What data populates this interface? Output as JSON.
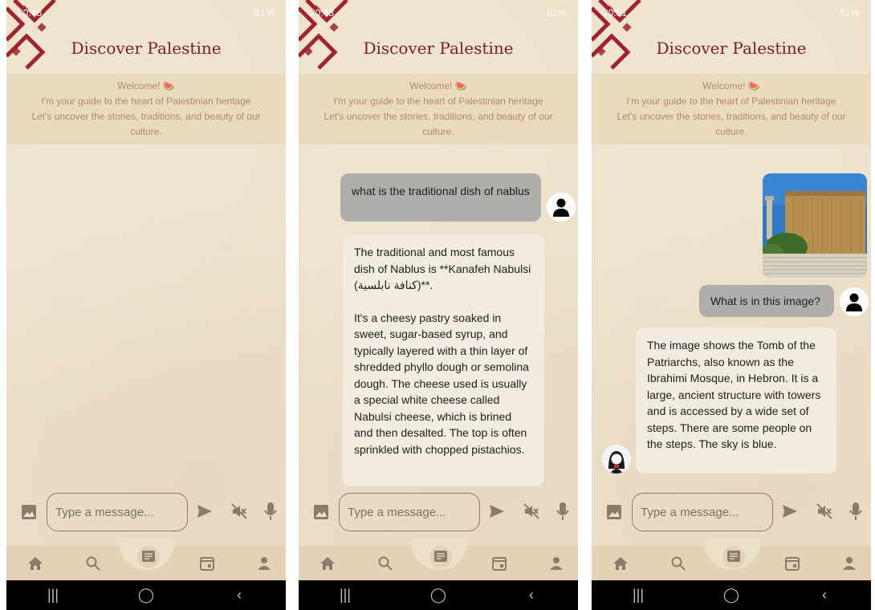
{
  "app": {
    "title": "Discover Palestine",
    "welcome_line1": "Welcome!",
    "welcome_emoji": "🍉",
    "welcome_line2": "I'm your guide to the heart of Palestinian heritage",
    "welcome_line3": "Let's uncover the stories, traditions, and beauty of our culture.",
    "input_placeholder": "Type a message...",
    "colors": {
      "background": "#ede0c8",
      "title": "#7a1f1f",
      "user_bubble": "#b0aeaa",
      "bot_bubble": "#f1ecdf",
      "nav_bar": "#e3d2b6",
      "pattern": "#a0242a"
    },
    "icons": {
      "image": "image-icon",
      "send": "send-icon",
      "mute": "speaker-mute-icon",
      "mic": "microphone-icon",
      "home": "home-icon",
      "search": "search-icon",
      "chat": "chat-icon",
      "calendar": "calendar-icon",
      "profile": "person-icon"
    }
  },
  "screens": [
    {
      "status_time": "20:48",
      "status_right": "51%"
    },
    {
      "status_time": "20:48",
      "status_right": "51%",
      "user_message": "what is the traditional dish of nablus",
      "bot_paragraph1": "The traditional and most famous dish of Nablus is **Kanafeh Nabulsi (كنافة نابلسية)**.",
      "bot_paragraph2": "It's a cheesy pastry soaked in sweet, sugar-based syrup, and typically layered with a thin layer of shredded phyllo dough or semolina dough.  The cheese used is usually a special white cheese called Nabulsi cheese, which is brined and then desalted. The top is often sprinkled with chopped pistachios."
    },
    {
      "status_time": "20:51",
      "status_right": "51%",
      "user_message": "What is in this image?",
      "bot_message": "The image shows the Tomb of the Patriarchs, also known as the Ibrahimi Mosque, in Hebron. It is a large, ancient structure with towers and is accessed by a wide set of steps. There are some people on the steps. The sky is blue."
    }
  ]
}
